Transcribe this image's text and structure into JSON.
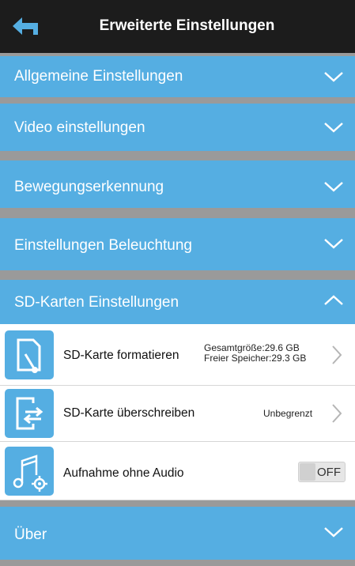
{
  "header": {
    "title": "Erweiterte Einstellungen"
  },
  "sections": {
    "general": "Allgemeine Einstellungen",
    "video": "Video einstellungen",
    "motion": "Bewegungserkennung",
    "lighting": "Einstellungen Beleuchtung",
    "sd": "SD-Karten Einstellungen",
    "about": "Über"
  },
  "sd_rows": {
    "format": {
      "label": "SD-Karte formatieren",
      "total": "Gesamtgröße:29.6 GB",
      "free": "Freier Speicher:29.3 GB"
    },
    "overwrite": {
      "label": "SD-Karte überschreiben",
      "value": "Unbegrenzt"
    },
    "no_audio": {
      "label": "Aufnahme ohne Audio",
      "toggle": "OFF"
    }
  },
  "icons": {
    "back": "back-arrow-icon",
    "expand": "chevron-down-icon",
    "collapse": "chevron-up-icon",
    "format": "sd-format-icon",
    "overwrite": "sd-overwrite-icon",
    "audio": "music-settings-icon",
    "next": "chevron-right-icon"
  },
  "colors": {
    "accent": "#55aee2",
    "header": "#1c1c1c",
    "divider": "#9a9a9a"
  }
}
